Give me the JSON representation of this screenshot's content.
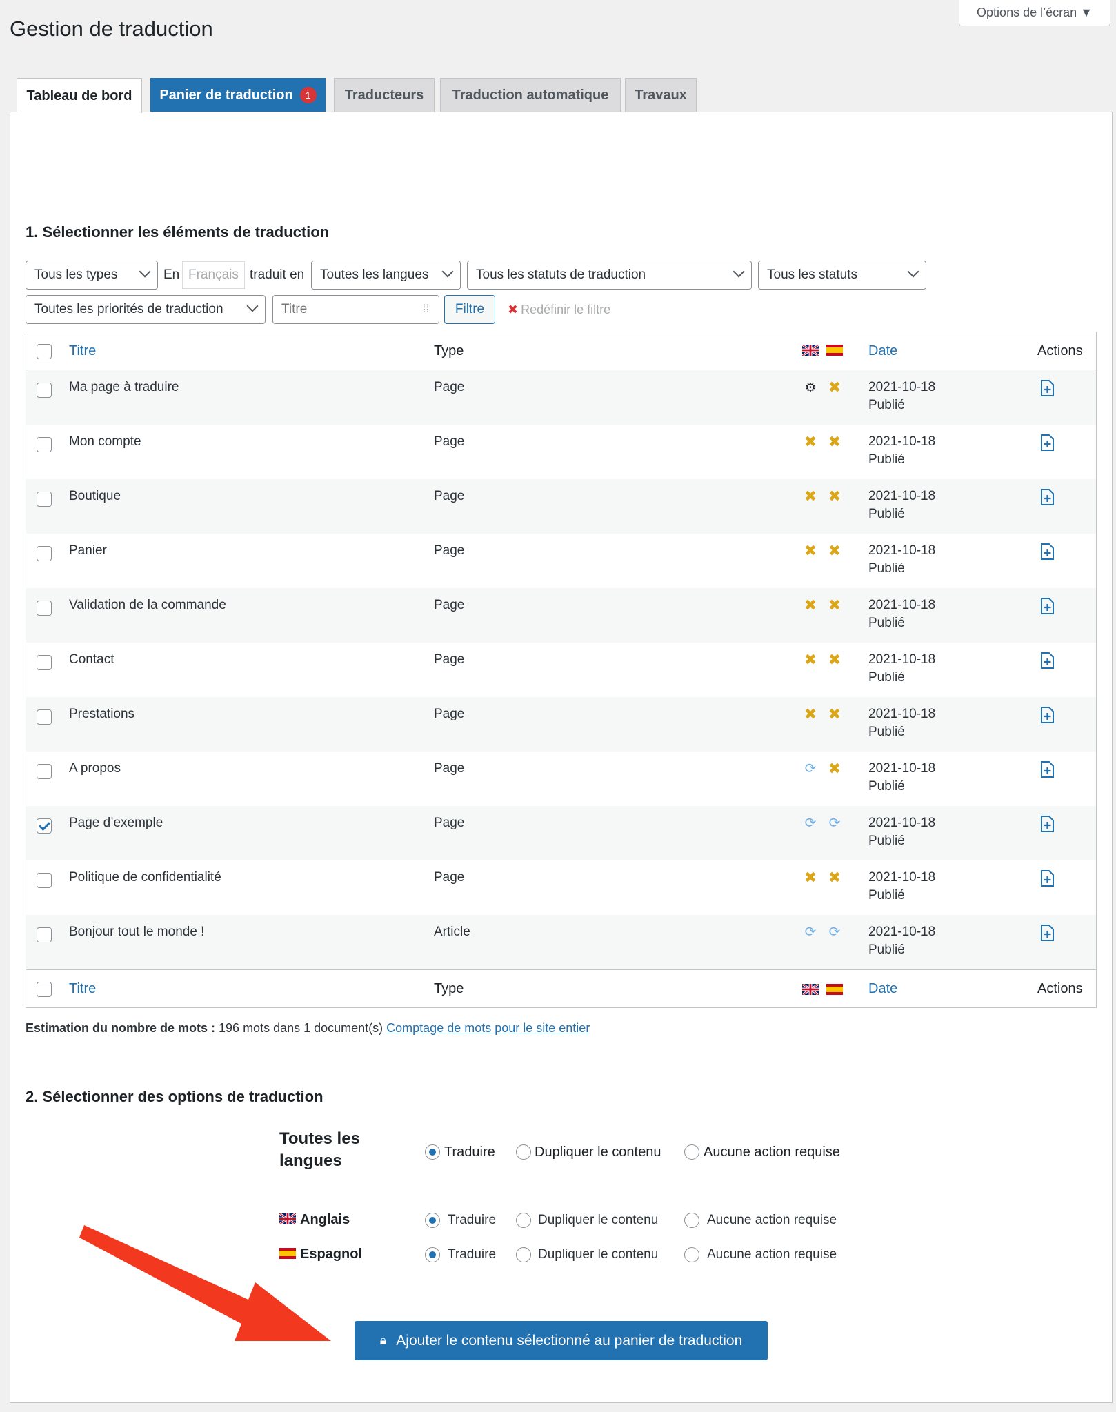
{
  "screen_options": "Options de l’écran ▼",
  "page_title": "Gestion de traduction",
  "tabs": [
    {
      "label": "Tableau de bord"
    },
    {
      "label": "Panier de traduction",
      "badge": "1"
    },
    {
      "label": "Traducteurs"
    },
    {
      "label": "Traduction automatique"
    },
    {
      "label": "Travaux"
    }
  ],
  "section1_title": "1. Sélectionner les éléments de traduction",
  "filters": {
    "types": "Tous les types",
    "en_label": "En",
    "source_lang": "Français",
    "translated_label": "traduit en",
    "languages": "Toutes les langues",
    "translation_statuses": "Tous les statuts de traduction",
    "statuses": "Tous les statuts",
    "priorities": "Toutes les priorités de traduction",
    "title_placeholder": "Titre",
    "filter_button": "Filtre",
    "reset_label": "Redéfinir le filtre"
  },
  "table": {
    "col_title": "Titre",
    "col_type": "Type",
    "col_date": "Date",
    "col_actions": "Actions",
    "rows": [
      {
        "title": "Ma page à traduire",
        "type": "Page",
        "en": "gear",
        "es": "x",
        "date": "2021-10-18",
        "status": "Publié",
        "checked": false
      },
      {
        "title": "Mon compte",
        "type": "Page",
        "en": "x",
        "es": "x",
        "date": "2021-10-18",
        "status": "Publié",
        "checked": false
      },
      {
        "title": "Boutique",
        "type": "Page",
        "en": "x",
        "es": "x",
        "date": "2021-10-18",
        "status": "Publié",
        "checked": false
      },
      {
        "title": "Panier",
        "type": "Page",
        "en": "x",
        "es": "x",
        "date": "2021-10-18",
        "status": "Publié",
        "checked": false
      },
      {
        "title": "Validation de la commande",
        "type": "Page",
        "en": "x",
        "es": "x",
        "date": "2021-10-18",
        "status": "Publié",
        "checked": false
      },
      {
        "title": "Contact",
        "type": "Page",
        "en": "x",
        "es": "x",
        "date": "2021-10-18",
        "status": "Publié",
        "checked": false
      },
      {
        "title": "Prestations",
        "type": "Page",
        "en": "x",
        "es": "x",
        "date": "2021-10-18",
        "status": "Publié",
        "checked": false
      },
      {
        "title": "A propos",
        "type": "Page",
        "en": "sync",
        "es": "x",
        "date": "2021-10-18",
        "status": "Publié",
        "checked": false
      },
      {
        "title": "Page d’exemple",
        "type": "Page",
        "en": "sync",
        "es": "sync",
        "date": "2021-10-18",
        "status": "Publié",
        "checked": true
      },
      {
        "title": "Politique de confidentialité",
        "type": "Page",
        "en": "x",
        "es": "x",
        "date": "2021-10-18",
        "status": "Publié",
        "checked": false
      },
      {
        "title": "Bonjour tout le monde !",
        "type": "Article",
        "en": "sync",
        "es": "sync",
        "date": "2021-10-18",
        "status": "Publié",
        "checked": false
      }
    ]
  },
  "word_count": {
    "label": "Estimation du nombre de mots :",
    "value": " 196 mots dans 1 document(s) ",
    "link": "Comptage de mots pour le site entier"
  },
  "section2_title": "2. Sélectionner des options de traduction",
  "options": {
    "all_languages_label": "Toutes les langues",
    "translate": "Traduire",
    "duplicate": "Dupliquer le contenu",
    "no_action": "Aucune action requise",
    "languages": [
      {
        "name": "Anglais"
      },
      {
        "name": "Espagnol"
      }
    ]
  },
  "add_button": "Ajouter le contenu sélectionné au panier de traduction",
  "colors": {
    "accent": "#2271b1",
    "status_x": "#dba617",
    "sync": "#72aee6",
    "annotation_arrow": "#f2391f"
  }
}
